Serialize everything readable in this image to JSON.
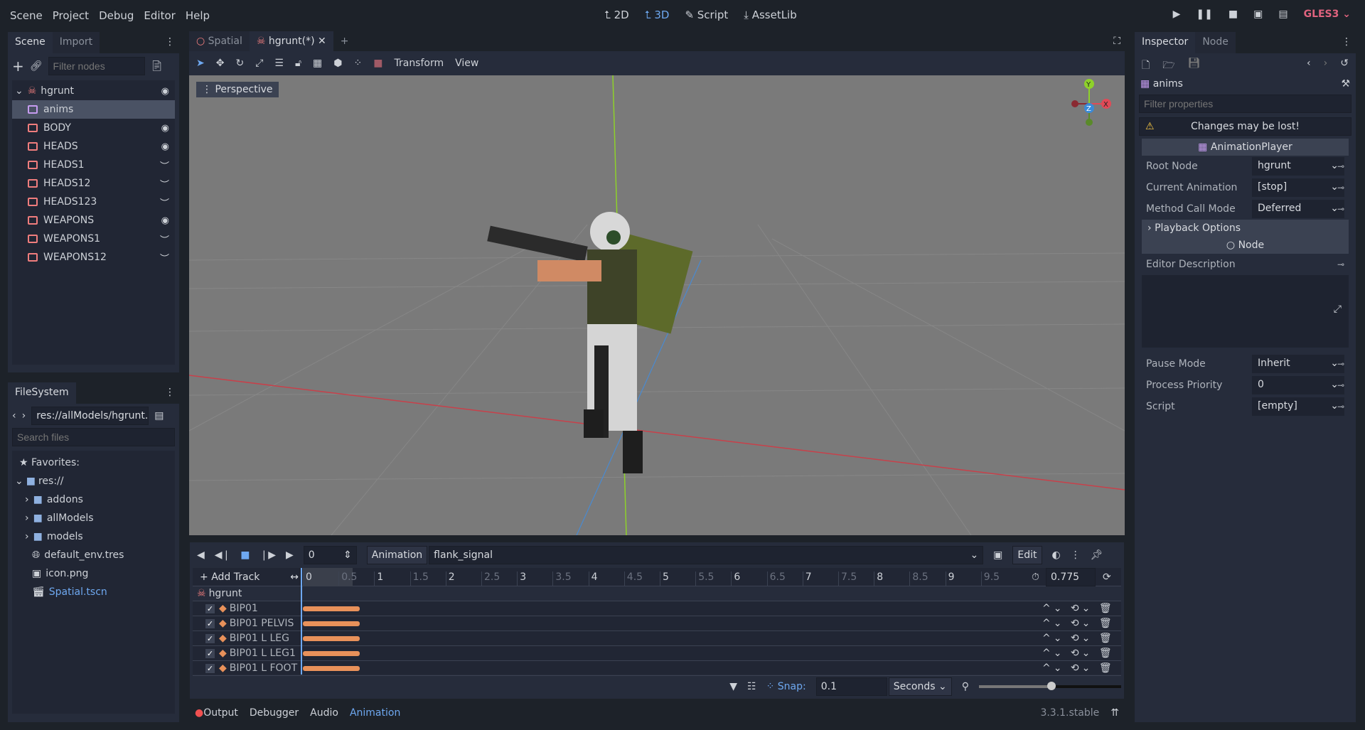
{
  "menu": [
    "Scene",
    "Project",
    "Debug",
    "Editor",
    "Help"
  ],
  "modes": {
    "d2": "2D",
    "d3": "3D",
    "script": "Script",
    "assetlib": "AssetLib"
  },
  "renderer": "GLES3",
  "scene_dock": {
    "tabs": [
      "Scene",
      "Import"
    ],
    "filter_placeholder": "Filter nodes",
    "root": "hgrunt",
    "items": [
      {
        "label": "anims",
        "eye": ""
      },
      {
        "label": "BODY",
        "eye": "visible"
      },
      {
        "label": "HEADS",
        "eye": "visible"
      },
      {
        "label": "HEADS1",
        "eye": "hidden"
      },
      {
        "label": "HEADS12",
        "eye": "hidden"
      },
      {
        "label": "HEADS123",
        "eye": "hidden"
      },
      {
        "label": "WEAPONS",
        "eye": "visible"
      },
      {
        "label": "WEAPONS1",
        "eye": "hidden"
      },
      {
        "label": "WEAPONS12",
        "eye": "hidden"
      }
    ]
  },
  "filesystem": {
    "tab": "FileSystem",
    "path": "res://allModels/hgrunt.",
    "search_placeholder": "Search files",
    "favorites": "Favorites:",
    "root": "res://",
    "folders": [
      "addons",
      "allModels",
      "models"
    ],
    "files": [
      "default_env.tres",
      "icon.png",
      "Spatial.tscn"
    ]
  },
  "editor_tabs": [
    {
      "label": "Spatial"
    },
    {
      "label": "hgrunt(*)"
    }
  ],
  "toolbar": {
    "transform": "Transform",
    "view": "View"
  },
  "viewport": {
    "perspective": "Perspective",
    "gizmo": {
      "y": "Y",
      "x": "X",
      "z": "Z"
    }
  },
  "animation": {
    "frame": "0",
    "label": "Animation",
    "current": "flank_signal",
    "edit": "Edit",
    "add_track": "Add Track",
    "ticks": [
      "0",
      "0.5",
      "1",
      "1.5",
      "2",
      "2.5",
      "3",
      "3.5",
      "4",
      "4.5",
      "5",
      "5.5",
      "6",
      "6.5",
      "7",
      "7.5",
      "8",
      "8.5",
      "9",
      "9.5"
    ],
    "length": "0.775",
    "root": "hgrunt",
    "tracks": [
      "BIP01",
      "BIP01 PELVIS",
      "BIP01 L LEG",
      "BIP01 L LEG1",
      "BIP01 L FOOT"
    ],
    "snap_label": "Snap:",
    "snap": "0.1",
    "unit": "Seconds"
  },
  "bottom_tabs": [
    "Output",
    "Debugger",
    "Audio",
    "Animation"
  ],
  "version": "3.3.1.stable",
  "inspector": {
    "tabs": [
      "Inspector",
      "Node"
    ],
    "object": "anims",
    "filter_placeholder": "Filter properties",
    "warning": "Changes may be lost!",
    "section": "AnimationPlayer",
    "node_section": "Node",
    "playback": "Playback Options",
    "props": [
      {
        "name": "Root Node",
        "value": "hgrunt"
      },
      {
        "name": "Current Animation",
        "value": "[stop]"
      },
      {
        "name": "Method Call Mode",
        "value": "Deferred"
      }
    ],
    "editor_description": "Editor Description",
    "props2": [
      {
        "name": "Pause Mode",
        "value": "Inherit"
      },
      {
        "name": "Process Priority",
        "value": "0"
      },
      {
        "name": "Script",
        "value": "[empty]"
      }
    ]
  }
}
